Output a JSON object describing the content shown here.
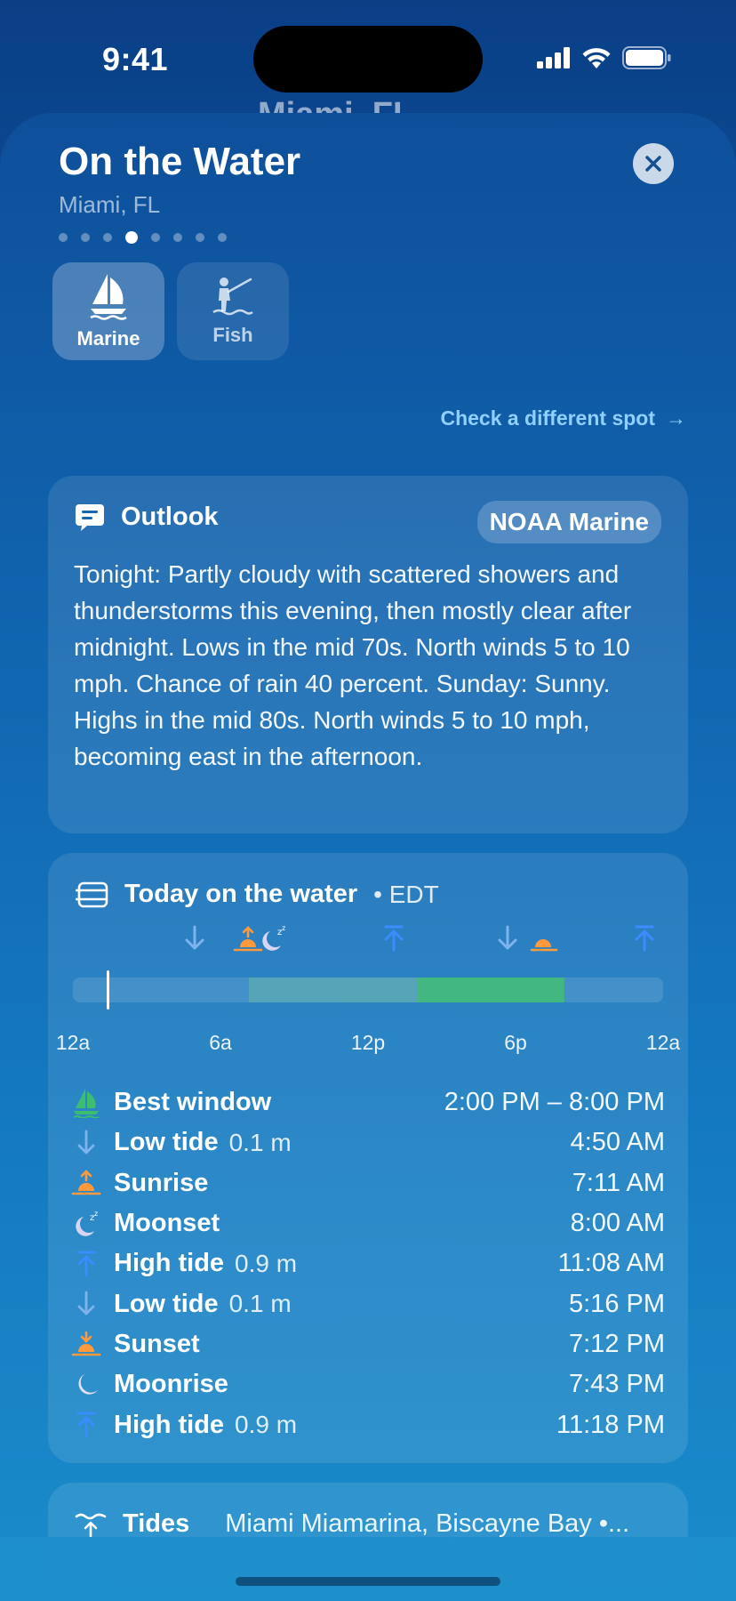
{
  "status": {
    "time": "9:41"
  },
  "background_title": "Miami, FL",
  "sheet": {
    "title": "On the Water",
    "subtitle": "Miami, FL",
    "page_count": 8,
    "active_page": 4
  },
  "modes": [
    {
      "label": "Marine",
      "icon": "sailboat-icon",
      "selected": true
    },
    {
      "label": "Fish",
      "icon": "fishing-icon",
      "selected": false
    }
  ],
  "check_link": {
    "label": "Check a different spot",
    "arrow": "→"
  },
  "outlook": {
    "title": "Outlook",
    "source": "NOAA Marine",
    "text": "Tonight: Partly cloudy with scattered showers and thunderstorms this evening, then mostly clear after midnight. Lows in the mid 70s. North winds 5 to 10 mph. Chance of rain 40 percent. Sunday: Sunny. Highs in the mid 80s. North winds 5 to 10 mph, becoming east in the afternoon."
  },
  "today": {
    "title": "Today on the water",
    "timezone": "• EDT",
    "timeline_ticks": [
      "12a",
      "6a",
      "12p",
      "6p",
      "12a"
    ],
    "events": [
      {
        "icon": "sailboat-icon",
        "name": "Best window",
        "value": "",
        "time": "2:00 PM – 8:00 PM"
      },
      {
        "icon": "low-tide-icon",
        "name": "Low tide",
        "value": "0.1 m",
        "time": "4:50 AM"
      },
      {
        "icon": "sunrise-icon",
        "name": "Sunrise",
        "value": "",
        "time": "7:11 AM"
      },
      {
        "icon": "moonset-icon",
        "name": "Moonset",
        "value": "",
        "time": "8:00 AM"
      },
      {
        "icon": "high-tide-icon",
        "name": "High tide",
        "value": "0.9 m",
        "time": "11:08 AM"
      },
      {
        "icon": "low-tide-icon",
        "name": "Low tide",
        "value": "0.1 m",
        "time": "5:16 PM"
      },
      {
        "icon": "sunset-icon",
        "name": "Sunset",
        "value": "",
        "time": "7:12 PM"
      },
      {
        "icon": "moonrise-icon",
        "name": "Moonrise",
        "value": "",
        "time": "7:43 PM"
      },
      {
        "icon": "high-tide-icon",
        "name": "High tide",
        "value": "0.9 m",
        "time": "11:18 PM"
      }
    ]
  },
  "tides": {
    "title": "Tides",
    "location": "Miami Miamarina, Biscayne Bay •..."
  },
  "colors": {
    "accent_link": "#8fd0ff",
    "best_window": "#3cbe6e",
    "tide_blue": "#3a8cff",
    "sun_orange": "#ff9a3c"
  }
}
